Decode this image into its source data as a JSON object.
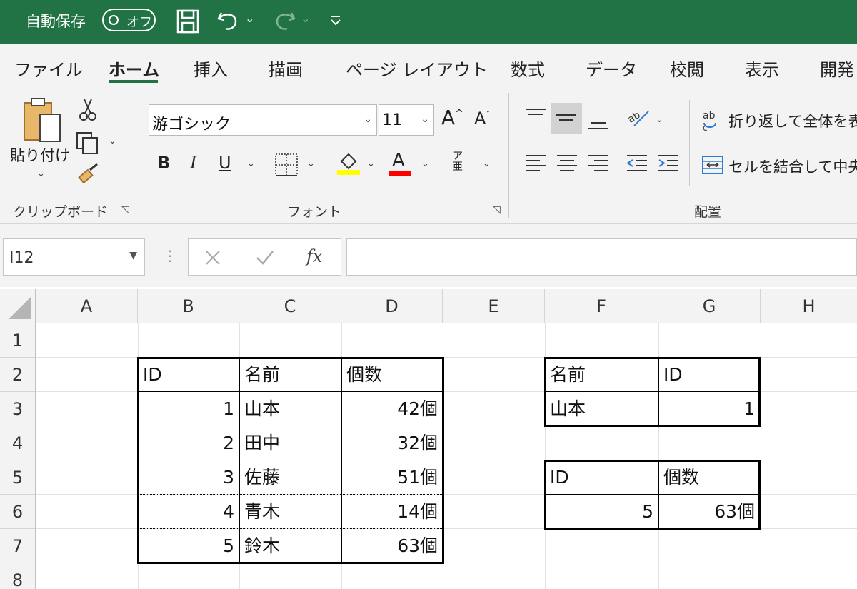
{
  "titlebar": {
    "autosave_label": "自動保存",
    "autosave_state": "オフ"
  },
  "tabs": [
    "ファイル",
    "ホーム",
    "挿入",
    "描画",
    "ページ レイアウト",
    "数式",
    "データ",
    "校閲",
    "表示",
    "開発"
  ],
  "active_tab": "ホーム",
  "ribbon": {
    "clipboard": {
      "paste_label": "貼り付け",
      "group_label": "クリップボード"
    },
    "font": {
      "font_name": "游ゴシック",
      "font_size": "11",
      "bold": "B",
      "italic": "I",
      "underline": "U",
      "font_color_glyph": "A",
      "phonetic_glyph": "ア亜",
      "group_label": "フォント",
      "fill_color": "#ffff00",
      "font_color": "#ff0000"
    },
    "alignment": {
      "wrap_text_label": "折り返して全体を表",
      "merge_center_label": "セルを結合して中央",
      "group_label": "配置"
    }
  },
  "formula_bar": {
    "name_box": "I12",
    "fx": "fx",
    "formula": ""
  },
  "sheet": {
    "columns": [
      "A",
      "B",
      "C",
      "D",
      "E",
      "F",
      "G",
      "H"
    ],
    "rows": [
      "1",
      "2",
      "3",
      "4",
      "5",
      "6",
      "7",
      "8"
    ],
    "cells": {
      "B2": "ID",
      "C2": "名前",
      "D2": "個数",
      "B3": "1",
      "C3": "山本",
      "D3": "42個",
      "B4": "2",
      "C4": "田中",
      "D4": "32個",
      "B5": "3",
      "C5": "佐藤",
      "D5": "51個",
      "B6": "4",
      "C6": "青木",
      "D6": "14個",
      "B7": "5",
      "C7": "鈴木",
      "D7": "63個",
      "F2": "名前",
      "G2": "ID",
      "F3": "山本",
      "G3": "1",
      "F5": "ID",
      "G5": "個数",
      "F6": "5",
      "G6": "63個"
    }
  },
  "colors": {
    "accent": "#217346",
    "ribbon_bg": "#f3f3f3"
  }
}
